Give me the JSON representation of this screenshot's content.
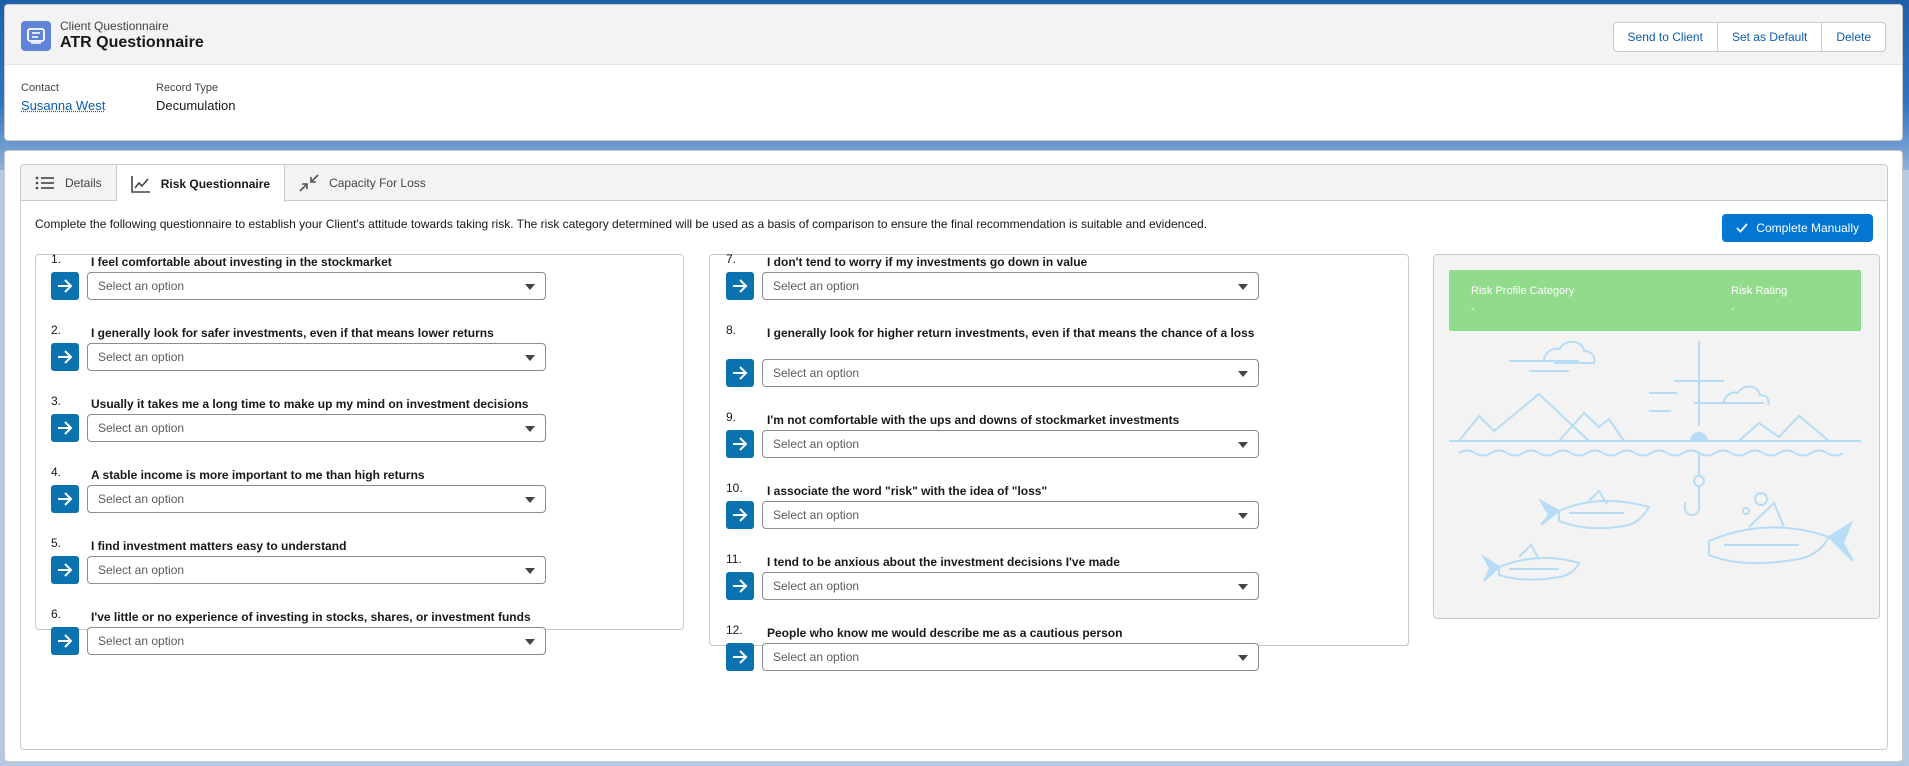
{
  "header": {
    "subtitle": "Client Questionnaire",
    "title": "ATR Questionnaire",
    "actions": [
      "Send to Client",
      "Set as Default",
      "Delete"
    ],
    "fields": [
      {
        "label": "Contact",
        "value": "Susanna West"
      },
      {
        "label": "Record Type",
        "value": "Decumulation"
      }
    ]
  },
  "tabs": [
    {
      "label": "Details",
      "icon": "list-icon"
    },
    {
      "label": "Risk Questionnaire",
      "icon": "line-chart-icon"
    },
    {
      "label": "Capacity For Loss",
      "icon": "collapse-arrows-icon"
    }
  ],
  "intro_text": "Complete the following questionnaire to establish your Client's attitude towards taking risk. The risk category determined will be used as a basis of comparison to ensure the final recommendation is suitable and evidenced.",
  "complete_button": "Complete Manually",
  "select_placeholder": "Select an option",
  "questions_left": [
    {
      "num": "1.",
      "text": "I feel comfortable about investing in the stockmarket"
    },
    {
      "num": "2.",
      "text": "I generally look for safer investments, even if that means lower returns"
    },
    {
      "num": "3.",
      "text": "Usually it takes me a long time to make up my mind on investment decisions"
    },
    {
      "num": "4.",
      "text": "A stable income is more important to me than high returns"
    },
    {
      "num": "5.",
      "text": "I find investment matters easy to understand"
    },
    {
      "num": "6.",
      "text": "I've little or no experience of investing in stocks, shares, or investment funds"
    }
  ],
  "questions_right": [
    {
      "num": "7.",
      "text": "I don't tend to worry if my investments go down in value"
    },
    {
      "num": "8.",
      "text": "I generally look for higher return investments, even if that means the chance of a loss"
    },
    {
      "num": "9.",
      "text": "I'm not comfortable with the ups and downs of stockmarket investments"
    },
    {
      "num": "10.",
      "text": "I associate the word \"risk\" with the idea of \"loss\""
    },
    {
      "num": "11.",
      "text": "I tend to be anxious about the investment decisions I've made"
    },
    {
      "num": "12.",
      "text": "People who know me would describe me as a cautious person"
    }
  ],
  "result": {
    "category_label": "Risk Profile Category",
    "category_value": "-",
    "rating_label": "Risk Rating",
    "rating_value": "-"
  },
  "colors": {
    "brand": "#0176d3",
    "arrow_button": "#0b72b0",
    "result_green": "#91db8b",
    "illustration": "#b7dcf5"
  }
}
